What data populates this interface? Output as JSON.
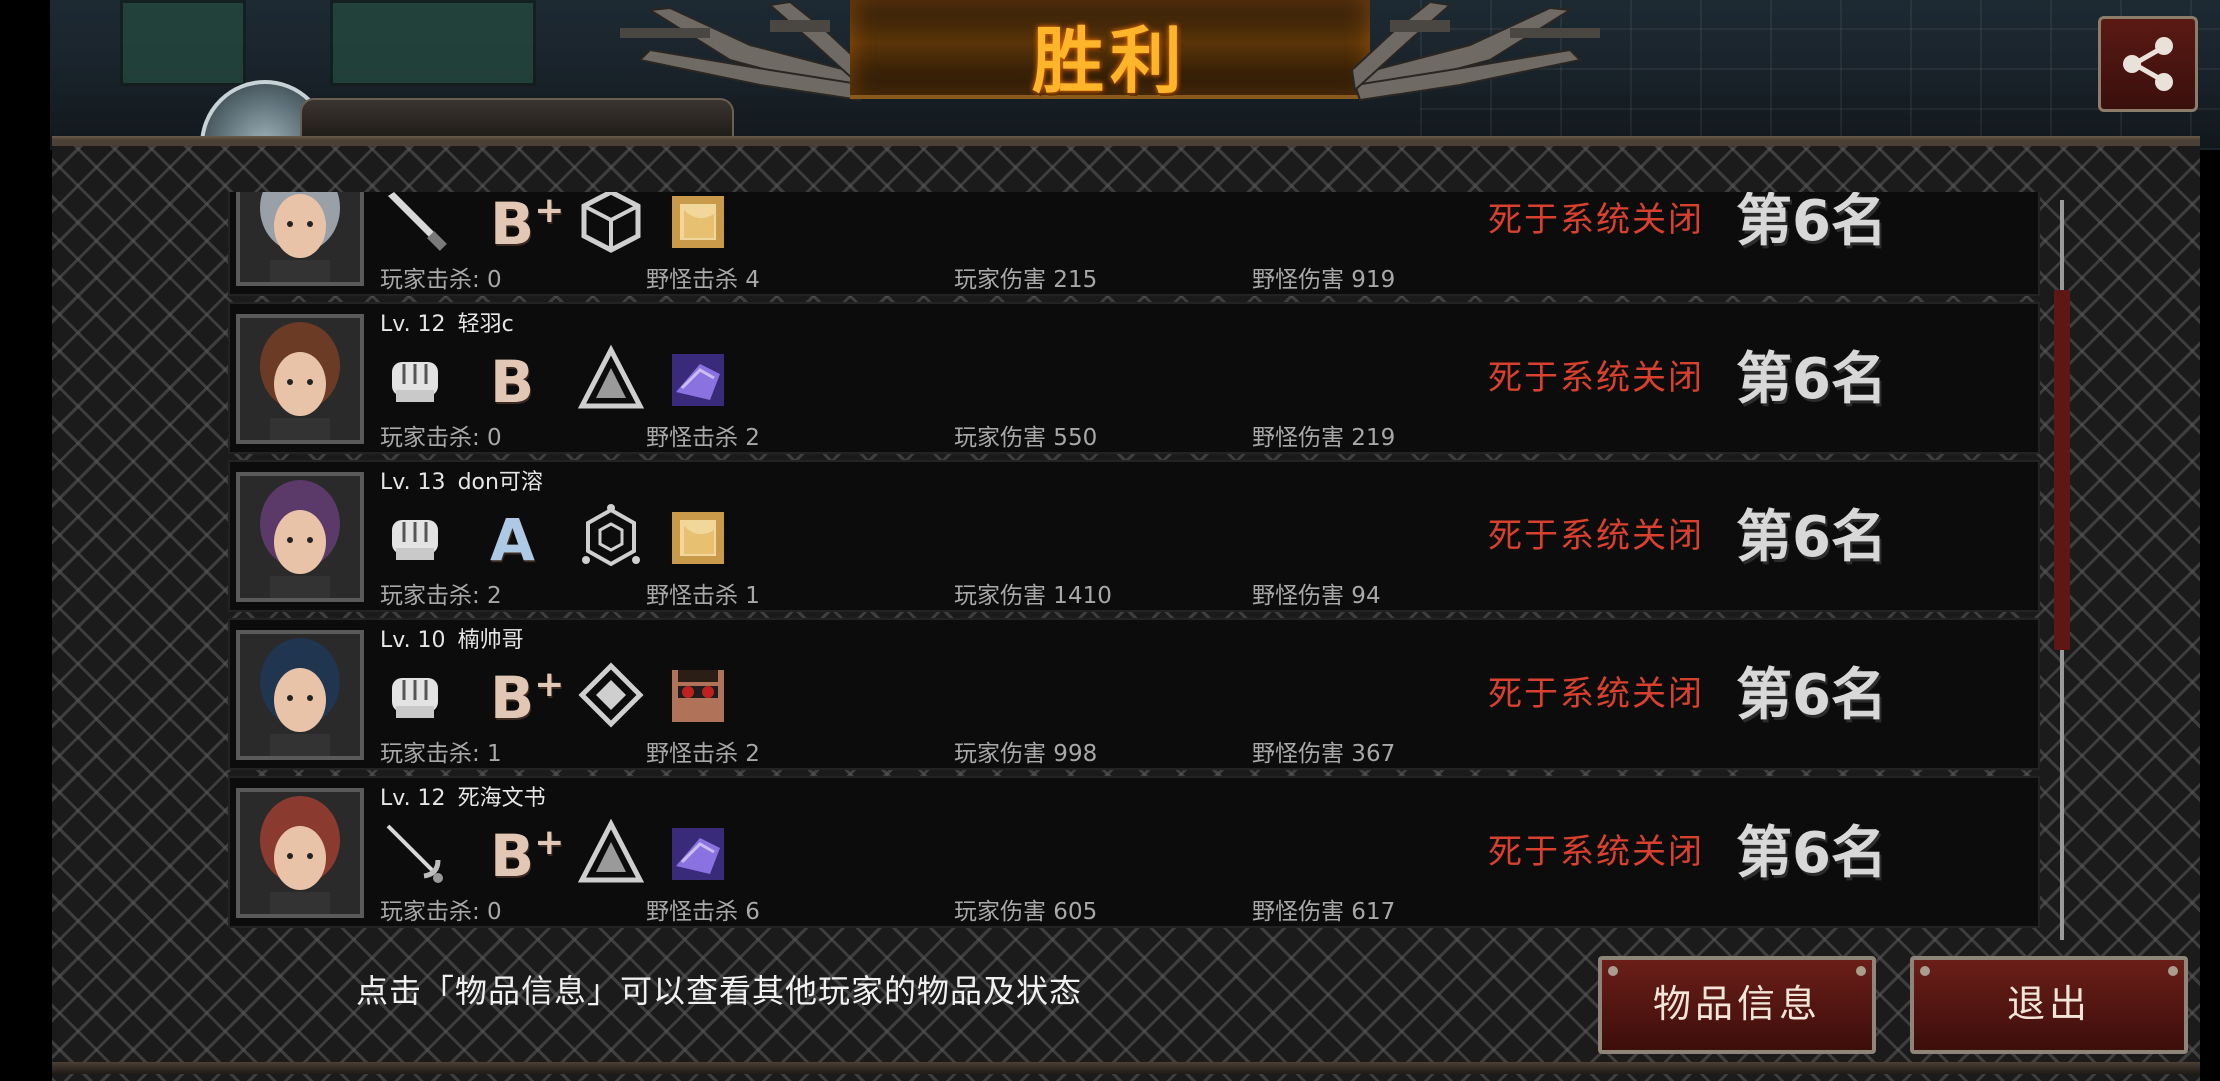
{
  "title": "胜利",
  "share": {
    "icon": "share-icon"
  },
  "players": [
    {
      "level": "",
      "name": "",
      "kills_label": "玩家击杀: 0",
      "monster_kills": "野怪击杀 4",
      "player_damage": "玩家伤害 215",
      "monster_damage": "野怪伤害 919",
      "weapon": "knife-icon",
      "grade": "B",
      "grade_plus": "+",
      "emblem": "cube-emblem-icon",
      "item": "gold-item-icon",
      "death": "死于系统关闭",
      "rank": "第6名",
      "avatar_color": "#9aa0a8"
    },
    {
      "level": "Lv. 12",
      "name": "轻羽c",
      "kills_label": "玩家击杀: 0",
      "monster_kills": "野怪击杀 2",
      "player_damage": "玩家伤害 550",
      "monster_damage": "野怪伤害 219",
      "weapon": "fist-icon",
      "grade": "B",
      "grade_plus": "",
      "emblem": "triangle-emblem-icon",
      "item": "purple-item-icon",
      "death": "死于系统关闭",
      "rank": "第6名",
      "avatar_color": "#6b3b25"
    },
    {
      "level": "Lv. 13",
      "name": "don可溶",
      "kills_label": "玩家击杀: 2",
      "monster_kills": "野怪击杀 1",
      "player_damage": "玩家伤害 1410",
      "monster_damage": "野怪伤害 94",
      "weapon": "fist-icon",
      "grade": "A",
      "grade_plus": "",
      "emblem": "hexagon-emblem-icon",
      "item": "gold-item-icon",
      "death": "死于系统关闭",
      "rank": "第6名",
      "avatar_color": "#5b3a6a"
    },
    {
      "level": "Lv. 10",
      "name": "楠帅哥",
      "kills_label": "玩家击杀: 1",
      "monster_kills": "野怪击杀 2",
      "player_damage": "玩家伤害 998",
      "monster_damage": "野怪伤害 367",
      "weapon": "fist-icon",
      "grade": "B",
      "grade_plus": "+",
      "emblem": "diamond-emblem-icon",
      "item": "face-item-icon",
      "death": "死于系统关闭",
      "rank": "第6名",
      "avatar_color": "#1f3550"
    },
    {
      "level": "Lv. 12",
      "name": "死海文书",
      "kills_label": "玩家击杀: 0",
      "monster_kills": "野怪击杀 6",
      "player_damage": "玩家伤害 605",
      "monster_damage": "野怪伤害 617",
      "weapon": "rapier-icon",
      "grade": "B",
      "grade_plus": "+",
      "emblem": "triangle-emblem-icon",
      "item": "purple-item-icon",
      "death": "死于系统关闭",
      "rank": "第6名",
      "avatar_color": "#8a3a2e"
    }
  ],
  "hint": "点击「物品信息」可以查看其他玩家的物品及状态",
  "buttons": {
    "items": "物品信息",
    "exit": "退出"
  },
  "colors": {
    "title": "#ffb52a",
    "death": "#d9412e",
    "button": "#6a1e18"
  }
}
